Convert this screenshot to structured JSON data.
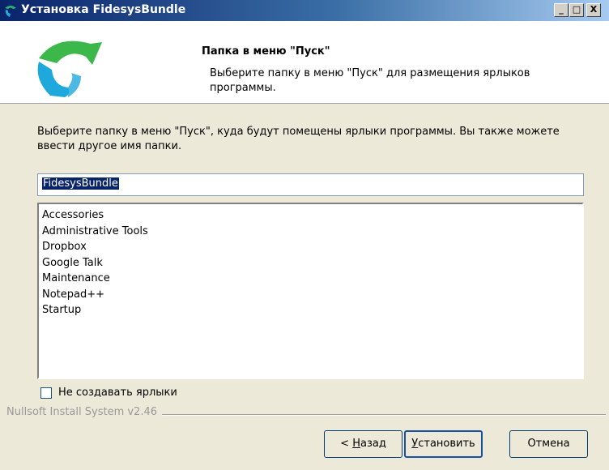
{
  "window": {
    "title": "Установка FidesysBundle",
    "minimize_glyph": "_",
    "maximize_glyph": "□",
    "close_glyph": "X"
  },
  "header": {
    "title": "Папка в меню \"Пуск\"",
    "subtitle": "Выберите папку в меню \"Пуск\" для размещения ярлыков программы."
  },
  "body": {
    "description": "Выберите папку в меню \"Пуск\", куда будут помещены ярлыки программы. Вы также можете ввести другое имя папки.",
    "folder_input_value": "FidesysBundle",
    "folders": [
      "Accessories",
      "Administrative Tools",
      "Dropbox",
      "Google Talk",
      "Maintenance",
      "Notepad++",
      "Startup"
    ],
    "no_shortcuts_label": "Не создавать ярлыки",
    "no_shortcuts_checked": false
  },
  "footer": {
    "branding": "Nullsoft Install System v2.46"
  },
  "buttons": {
    "back_prefix": "< ",
    "back_mnemonic": "Н",
    "back_rest": "азад",
    "install_mnemonic": "У",
    "install_rest": "становить",
    "cancel": "Отмена"
  },
  "colors": {
    "titlebar_start": "#0a246a",
    "selection": "#0a246a",
    "dialog_bg": "#ece9d8"
  }
}
